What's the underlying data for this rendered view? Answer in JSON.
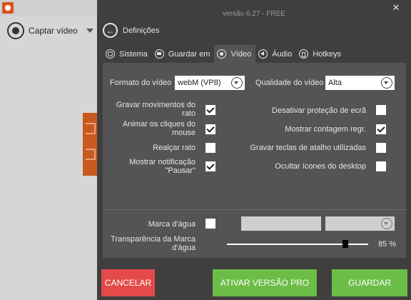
{
  "background": {
    "record_label": "Captar vídeo"
  },
  "dialog": {
    "version": "versão 6.27 - FREE",
    "close_glyph": "✕",
    "back_glyph": "←",
    "title": "Definições",
    "tabs": [
      {
        "label": "Sistema",
        "icon": "gear-icon",
        "active": false
      },
      {
        "label": "Guardar em",
        "icon": "folder-icon",
        "active": false
      },
      {
        "label": "Vídeo",
        "icon": "video-icon",
        "active": true
      },
      {
        "label": "Áudio",
        "icon": "audio-icon",
        "active": false
      },
      {
        "label": "Hotkeys",
        "icon": "hotkeys-icon",
        "active": false
      }
    ],
    "video_format": {
      "label": "Formato do vídeo",
      "value": "webM (VP8)"
    },
    "video_quality": {
      "label": "Qualidade do vídeo",
      "value": "Alta"
    },
    "options_left": [
      {
        "label": "Gravar movimentos do rato",
        "checked": true
      },
      {
        "label": "Animar os cliques do mouse",
        "checked": true
      },
      {
        "label": "Realçar rato",
        "checked": false
      },
      {
        "label": "Mostrar notificação \"Pausar\"",
        "checked": true
      }
    ],
    "options_right": [
      {
        "label": "Desativar proteção de ecrã",
        "checked": false
      },
      {
        "label": "Mostrar contagem regr.",
        "checked": true
      },
      {
        "label": "Gravar teclas de atalho utilizadas",
        "checked": false
      },
      {
        "label": "Ocultar ícones do desktop",
        "checked": false
      }
    ],
    "watermark": {
      "label": "Marca d'água",
      "checked": false
    },
    "transparency": {
      "label": "Transparência da Marca d'água",
      "value_text": "85 %",
      "value": 85
    },
    "buttons": {
      "cancel": "CANCELAR",
      "pro": "ATIVAR VERSÃO PRO",
      "save": "GUARDAR"
    }
  },
  "colors": {
    "dialog_bg": "#3f3f3f",
    "panel_bg": "#545454",
    "cancel": "#e54a4a",
    "green": "#6cbd47",
    "brand": "#d9541e"
  }
}
